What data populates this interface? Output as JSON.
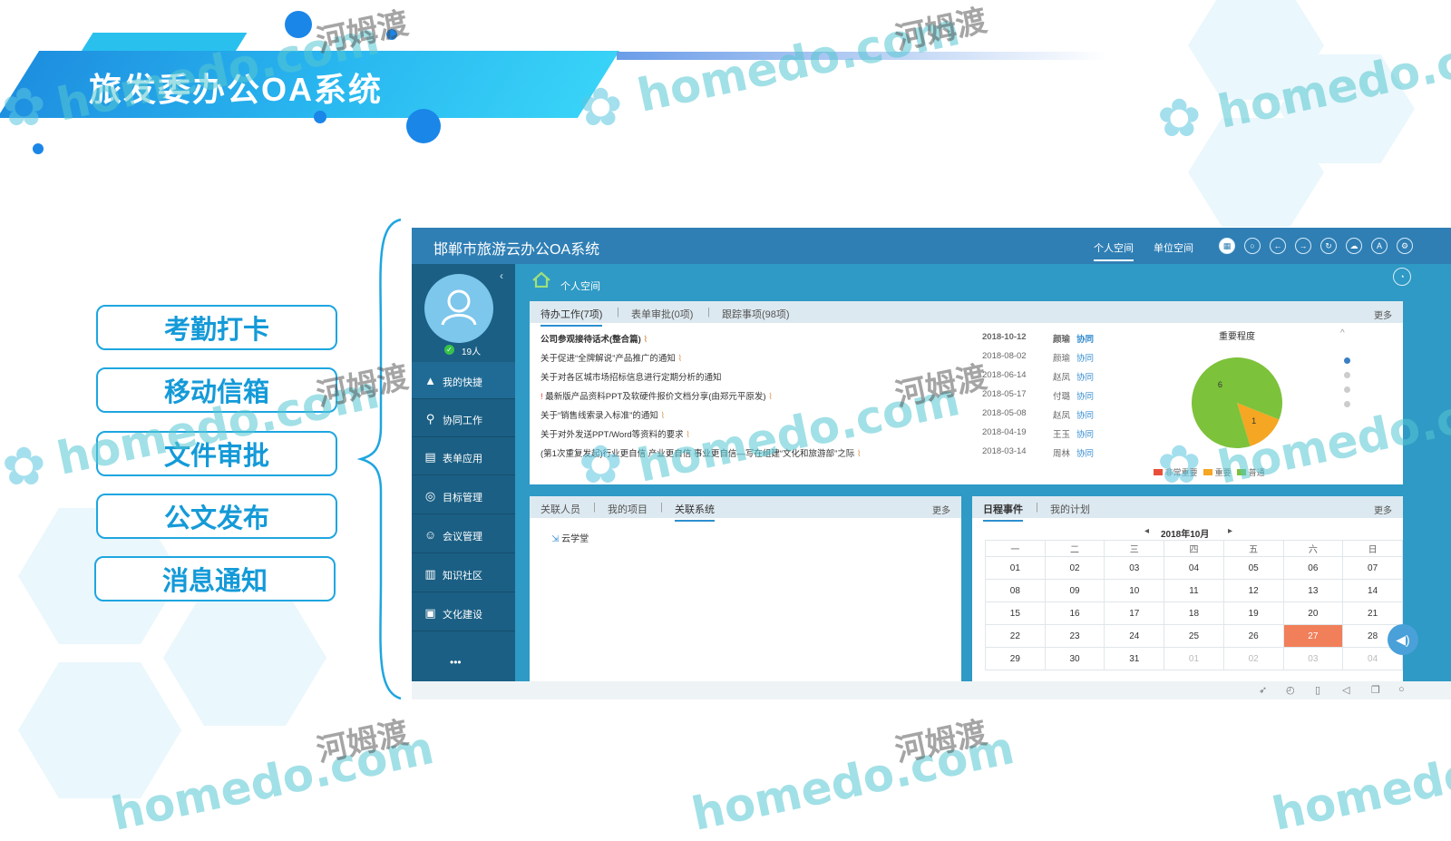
{
  "page_title": "旅发委办公OA系统",
  "menu_items": [
    "考勤打卡",
    "移动信箱",
    "文件审批",
    "公文发布",
    "消息通知"
  ],
  "app": {
    "title": "邯郸市旅游云办公OA系统",
    "tabs": [
      "个人空间",
      "单位空间"
    ],
    "user_count": "19人",
    "breadcrumb": "个人空间",
    "sidebar": [
      "我的快捷",
      "协同工作",
      "表单应用",
      "目标管理",
      "会议管理",
      "知识社区",
      "文化建设"
    ],
    "sidebar_more": "•••",
    "todo": {
      "tabs": [
        "待办工作(7项)",
        "表单审批(0项)",
        "跟踪事项(98项)"
      ],
      "more": "更多",
      "rows": [
        {
          "title": "公司参观接待话术(整合篇)",
          "date": "2018-10-12",
          "person": "颜瑜",
          "tag": "协同"
        },
        {
          "title": "关于促进“全牌解说”产品推广的通知",
          "date": "2018-08-02",
          "person": "颜瑜",
          "tag": "协同"
        },
        {
          "title": "关于对各区城市场招标信息进行定期分析的通知",
          "date": "2018-06-14",
          "person": "赵凤",
          "tag": "协同"
        },
        {
          "title": "最新版产品资料PPT及软硬件报价文档分享(由郑元平原发)",
          "date": "2018-05-17",
          "person": "付璐",
          "tag": "协同"
        },
        {
          "title": "关于“销售线索录入标准”的通知",
          "date": "2018-05-08",
          "person": "赵凤",
          "tag": "协同"
        },
        {
          "title": "关于对外发送PPT/Word等资料的要求",
          "date": "2018-04-19",
          "person": "王玉",
          "tag": "协同"
        },
        {
          "title": "(第1次重复发起)行业更自信 产业更自信 事业更自信—写在组建“文化和旅游部”之际",
          "date": "2018-03-14",
          "person": "周林",
          "tag": "协同"
        }
      ],
      "urgent_mark": "!"
    },
    "related": {
      "tabs": [
        "关联人员",
        "我的项目",
        "关联系统"
      ],
      "more": "更多",
      "items": [
        "云学堂"
      ]
    },
    "schedule": {
      "tabs": [
        "日程事件",
        "我的计划"
      ],
      "more": "更多",
      "month": "2018年10月",
      "prev": "◂",
      "next": "▸",
      "weekdays": [
        "一",
        "二",
        "三",
        "四",
        "五",
        "六",
        "日"
      ],
      "weeks": [
        [
          "01",
          "02",
          "03",
          "04",
          "05",
          "06",
          "07"
        ],
        [
          "08",
          "09",
          "10",
          "11",
          "12",
          "13",
          "14"
        ],
        [
          "15",
          "16",
          "17",
          "18",
          "19",
          "20",
          "21"
        ],
        [
          "22",
          "23",
          "24",
          "25",
          "26",
          "27",
          "28"
        ],
        [
          "29",
          "30",
          "31",
          "01",
          "02",
          "03",
          "04"
        ]
      ],
      "today": "27",
      "today_color": "#f07f5a"
    }
  },
  "chart_data": {
    "type": "pie",
    "title": "重要程度",
    "categories": [
      "非常重要",
      "重要",
      "普通"
    ],
    "values": [
      0,
      1,
      6
    ],
    "colors": [
      "#e84f3a",
      "#f5a623",
      "#7cc23b"
    ]
  },
  "watermarks": [
    "homedo.com",
    "河姆渡"
  ],
  "colors": {
    "accent": "#1ea6e0",
    "banner": "#29b8f0",
    "app_header": "#2f7fb5",
    "sidebar": "#1b5f84"
  }
}
